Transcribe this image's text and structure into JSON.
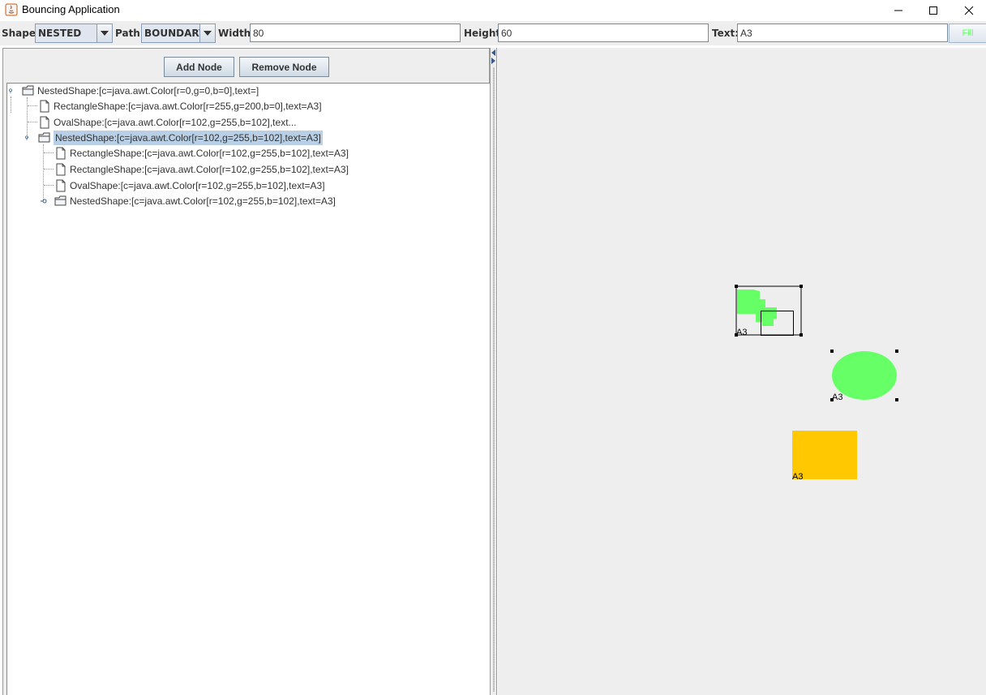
{
  "window": {
    "title": "Bouncing Application",
    "minimize_icon": "minimize-icon",
    "maximize_icon": "maximize-icon",
    "close_icon": "close-icon"
  },
  "toolbar": {
    "shape_label": "Shape:",
    "shape_value": "NESTED",
    "path_label": "Path:",
    "path_value": "BOUNDARY",
    "width_label": "Width:",
    "width_value": "80",
    "height_label": "Height:",
    "height_value": "60",
    "text_label": "Text:",
    "text_value": "A3",
    "fill_label": "Fill",
    "fill_color": "#66ff66"
  },
  "left_panel": {
    "add_node_label": "Add Node",
    "remove_node_label": "Remove Node",
    "tree": [
      {
        "label": "NestedShape:[c=java.awt.Color[r=0,g=0,b=0],text=]",
        "type": "folder",
        "depth": 0,
        "expanded": true,
        "selected": false
      },
      {
        "label": "RectangleShape:[c=java.awt.Color[r=255,g=200,b=0],text=A3]",
        "type": "leaf",
        "depth": 1,
        "selected": false
      },
      {
        "label": "OvalShape:[c=java.awt.Color[r=102,g=255,b=102],text...",
        "type": "leaf",
        "depth": 1,
        "selected": false
      },
      {
        "label": "NestedShape:[c=java.awt.Color[r=102,g=255,b=102],text=A3]",
        "type": "folder",
        "depth": 1,
        "expanded": true,
        "selected": true
      },
      {
        "label": "RectangleShape:[c=java.awt.Color[r=102,g=255,b=102],text=A3]",
        "type": "leaf",
        "depth": 2,
        "selected": false
      },
      {
        "label": "RectangleShape:[c=java.awt.Color[r=102,g=255,b=102],text=A3]",
        "type": "leaf",
        "depth": 2,
        "selected": false
      },
      {
        "label": "OvalShape:[c=java.awt.Color[r=102,g=255,b=102],text=A3]",
        "type": "leaf",
        "depth": 2,
        "selected": false
      },
      {
        "label": "NestedShape:[c=java.awt.Color[r=102,g=255,b=102],text=A3]",
        "type": "folder",
        "depth": 2,
        "expanded": false,
        "selected": false
      }
    ]
  },
  "canvas": {
    "background": "#eeeeee",
    "shapes": [
      {
        "kind": "nested",
        "text": "A3",
        "selected": true,
        "color": "#66ff66"
      },
      {
        "kind": "oval",
        "text": "A3",
        "selected": true,
        "color": "#66ff66"
      },
      {
        "kind": "rectangle",
        "text": "A3",
        "selected": false,
        "color": "#ffc800"
      }
    ]
  }
}
